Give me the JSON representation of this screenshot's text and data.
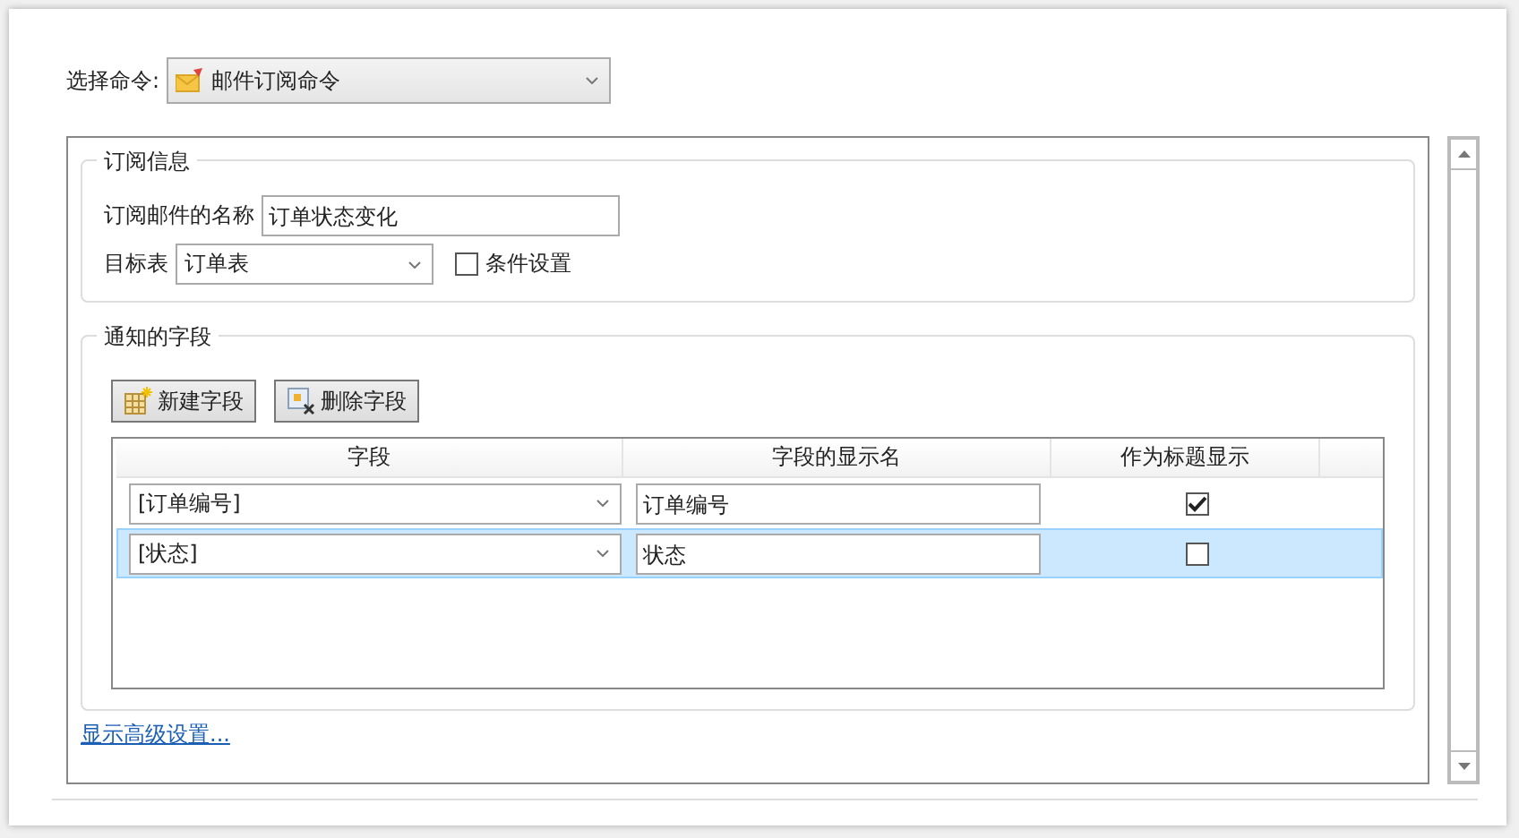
{
  "command": {
    "label": "选择命令:",
    "value": "邮件订阅命令"
  },
  "subscription": {
    "title": "订阅信息",
    "name_label": "订阅邮件的名称",
    "name_value": "订单状态变化",
    "table_label": "目标表",
    "table_value": "订单表",
    "condition": {
      "label": "条件设置",
      "checked": false
    }
  },
  "fields": {
    "title": "通知的字段",
    "buttons": [
      {
        "kind": "add",
        "label": "新建字段"
      },
      {
        "kind": "delete",
        "label": "删除字段"
      }
    ],
    "columns": [
      "字段",
      "字段的显示名",
      "作为标题显示"
    ],
    "rows": [
      {
        "field": "[订单编号]",
        "display_name": "订单编号",
        "as_title": true,
        "selected": false
      },
      {
        "field": "[状态]",
        "display_name": "状态",
        "as_title": false,
        "selected": true
      }
    ]
  },
  "advanced_link": "显示高级设置..."
}
